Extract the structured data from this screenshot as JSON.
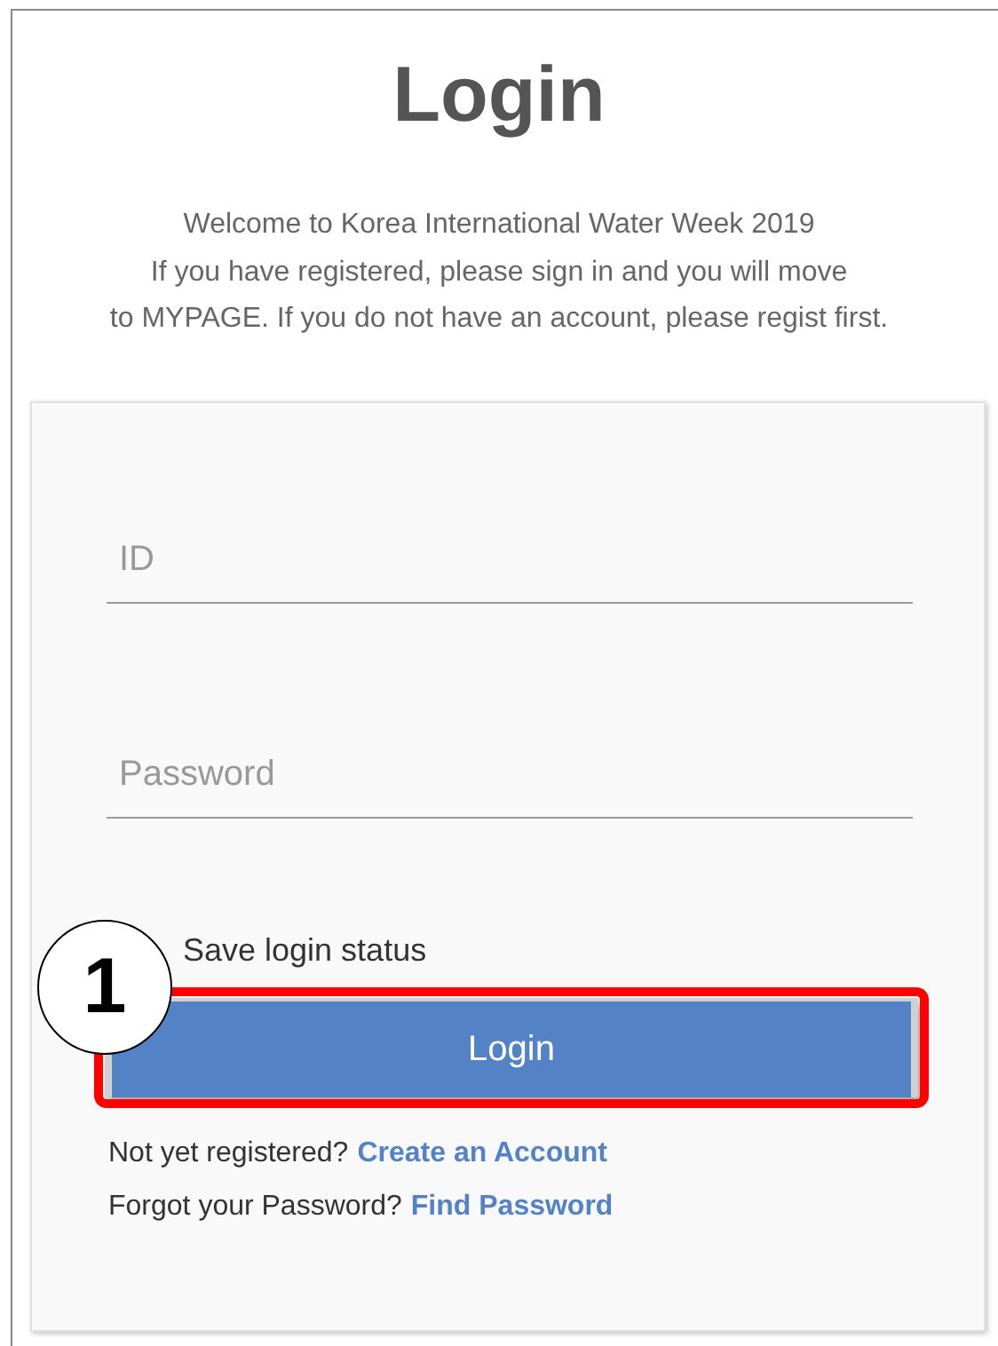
{
  "title": "Login",
  "intro": [
    "Welcome to Korea International Water Week 2019",
    "If you have registered, please sign in and you will move",
    "to MYPAGE. If you do not have an account, please regist first."
  ],
  "fields": [
    {
      "placeholder": "ID"
    },
    {
      "placeholder": "Password"
    }
  ],
  "save_login": {
    "label": "Save login status"
  },
  "login_button": {
    "label": "Login"
  },
  "links": [
    {
      "text": "Not yet registered?",
      "link": "Create an Account"
    },
    {
      "text": "Forgot your Password?",
      "link": "Find Password"
    }
  ],
  "annotation": {
    "number": "1"
  }
}
